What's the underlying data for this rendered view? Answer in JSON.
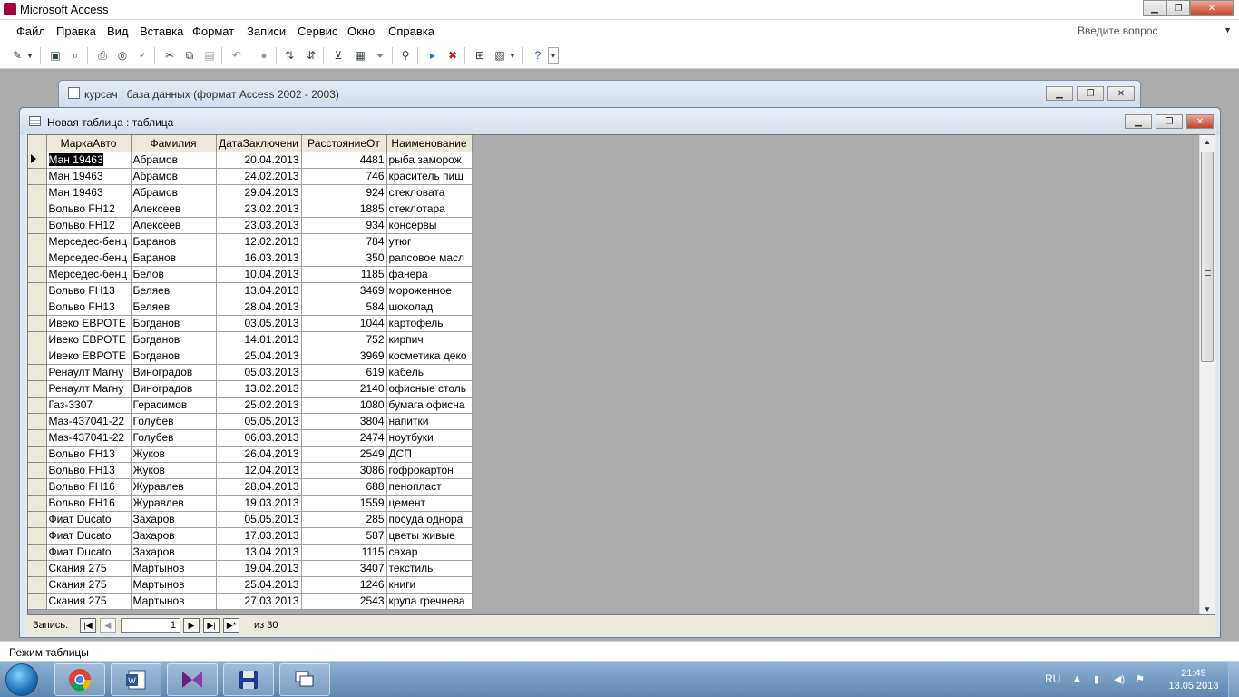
{
  "app": {
    "title": "Microsoft Access"
  },
  "menu": {
    "items": [
      "Файл",
      "Правка",
      "Вид",
      "Вставка",
      "Формат",
      "Записи",
      "Сервис",
      "Окно",
      "Справка"
    ],
    "ask_placeholder": "Введите вопрос"
  },
  "db_window": {
    "title": "курсач : база данных (формат Access 2002 - 2003)"
  },
  "table_window": {
    "title": "Новая таблица : таблица"
  },
  "table": {
    "columns": [
      "МаркаАвто",
      "Фамилия",
      "ДатаЗаключени",
      "РасстояниеОт",
      "Наименование"
    ],
    "rows": [
      [
        "Ман 19463",
        "Абрамов",
        "20.04.2013",
        "4481",
        "рыба заморож"
      ],
      [
        "Ман 19463",
        "Абрамов",
        "24.02.2013",
        "746",
        "краситель пищ"
      ],
      [
        "Ман 19463",
        "Абрамов",
        "29.04.2013",
        "924",
        "стекловата"
      ],
      [
        "Вольво FH12",
        "Алексеев",
        "23.02.2013",
        "1885",
        "стеклотара"
      ],
      [
        "Вольво FH12",
        "Алексеев",
        "23.03.2013",
        "934",
        "консервы"
      ],
      [
        "Мерседес-бенц",
        "Баранов",
        "12.02.2013",
        "784",
        "утюг"
      ],
      [
        "Мерседес-бенц",
        "Баранов",
        "16.03.2013",
        "350",
        "рапсовое масл"
      ],
      [
        "Мерседес-бенц",
        "Белов",
        "10.04.2013",
        "1185",
        "фанера"
      ],
      [
        "Вольво FH13",
        "Беляев",
        "13.04.2013",
        "3469",
        "мороженное"
      ],
      [
        "Вольво FH13",
        "Беляев",
        "28.04.2013",
        "584",
        "шоколад"
      ],
      [
        "Ивеко ЕВРОТЕ",
        "Богданов",
        "03.05.2013",
        "1044",
        "картофель"
      ],
      [
        "Ивеко ЕВРОТЕ",
        "Богданов",
        "14.01.2013",
        "752",
        "кирпич"
      ],
      [
        "Ивеко ЕВРОТЕ",
        "Богданов",
        "25.04.2013",
        "3969",
        "косметика деко"
      ],
      [
        "Ренаулт Магну",
        "Виноградов",
        "05.03.2013",
        "619",
        "кабель"
      ],
      [
        "Ренаулт Магну",
        "Виноградов",
        "13.02.2013",
        "2140",
        "офисные столь"
      ],
      [
        "Газ-3307",
        "Герасимов",
        "25.02.2013",
        "1080",
        "бумага офисна"
      ],
      [
        "Маз-437041-22",
        "Голубев",
        "05.05.2013",
        "3804",
        "напитки"
      ],
      [
        "Маз-437041-22",
        "Голубев",
        "06.03.2013",
        "2474",
        "ноутбуки"
      ],
      [
        "Вольво FH13",
        "Жуков",
        "26.04.2013",
        "2549",
        "ДСП"
      ],
      [
        "Вольво FH13",
        "Жуков",
        "12.04.2013",
        "3086",
        "гофрокартон"
      ],
      [
        "Вольво FH16",
        "Журавлев",
        "28.04.2013",
        "688",
        "пенопласт"
      ],
      [
        "Вольво FH16",
        "Журавлев",
        "19.03.2013",
        "1559",
        "цемент"
      ],
      [
        "Фиат Ducato",
        "Захаров",
        "05.05.2013",
        "285",
        "посуда однора"
      ],
      [
        "Фиат Ducato",
        "Захаров",
        "17.03.2013",
        "587",
        "цветы живые"
      ],
      [
        "Фиат Ducato",
        "Захаров",
        "13.04.2013",
        "1115",
        "сахар"
      ],
      [
        "Скания 275",
        "Мартынов",
        "19.04.2013",
        "3407",
        "текстиль"
      ],
      [
        "Скания 275",
        "Мартынов",
        "25.04.2013",
        "1246",
        "книги"
      ],
      [
        "Скания 275",
        "Мартынов",
        "27.03.2013",
        "2543",
        "крупа гречнева"
      ]
    ]
  },
  "nav": {
    "label": "Запись:",
    "current": "1",
    "of_label": "из  30"
  },
  "status": {
    "text": "Режим таблицы"
  },
  "tray": {
    "lang": "RU",
    "time": "21:49",
    "date": "13.05.2013"
  }
}
